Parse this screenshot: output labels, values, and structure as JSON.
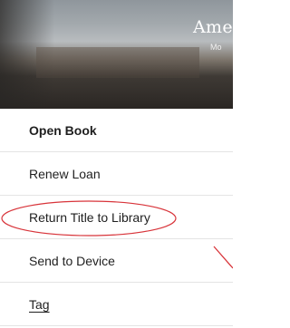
{
  "header": {
    "title": "Ame",
    "subtitle": "Mo"
  },
  "menu": {
    "items": [
      {
        "label": "Open Book"
      },
      {
        "label": "Renew Loan"
      },
      {
        "label": "Return Title to Library"
      },
      {
        "label": "Send to Device"
      },
      {
        "label": "Tag"
      }
    ]
  },
  "annotation": {
    "color": "#d8343a"
  }
}
